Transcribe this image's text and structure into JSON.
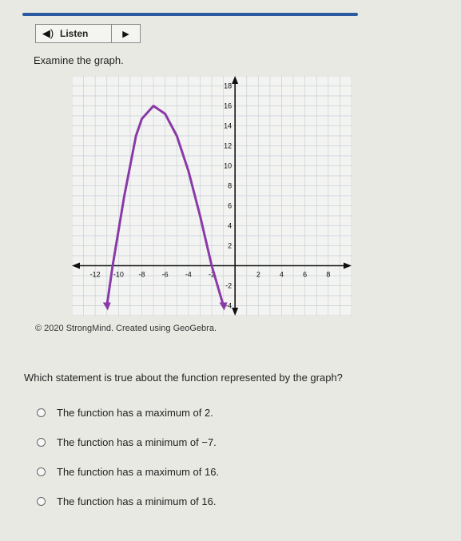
{
  "toolbar": {
    "listen_label": "Listen"
  },
  "prompt": "Examine the graph.",
  "credit": "© 2020 StrongMind. Created using GeoGebra.",
  "question": "Which statement is true about the function represented by the graph?",
  "options": [
    "The function has a maximum of 2.",
    "The function has a minimum of −7.",
    "The function has a maximum of 16.",
    "The function has a minimum of 16."
  ],
  "chart_data": {
    "type": "line",
    "x_ticks": [
      "-12",
      "-10",
      "-8",
      "-6",
      "-4",
      "-2",
      "2",
      "4",
      "6",
      "8"
    ],
    "y_ticks": [
      "18",
      "16",
      "14",
      "12",
      "10",
      "8",
      "6",
      "4",
      "2",
      "-2",
      "-4"
    ],
    "xlim": [
      -14,
      10
    ],
    "ylim": [
      -5,
      19
    ],
    "vertex": [
      -7,
      16
    ],
    "curve_color": "#8a3aa8",
    "series": [
      {
        "points": [
          [
            -11,
            -4
          ],
          [
            -10.5,
            0
          ],
          [
            -9.5,
            7
          ],
          [
            -8.5,
            13
          ],
          [
            -8,
            14.7
          ],
          [
            -7,
            16
          ],
          [
            -6,
            15.2
          ],
          [
            -5,
            13
          ],
          [
            -4,
            9.5
          ],
          [
            -3,
            5
          ],
          [
            -2,
            0
          ],
          [
            -1,
            -4
          ]
        ]
      }
    ]
  }
}
